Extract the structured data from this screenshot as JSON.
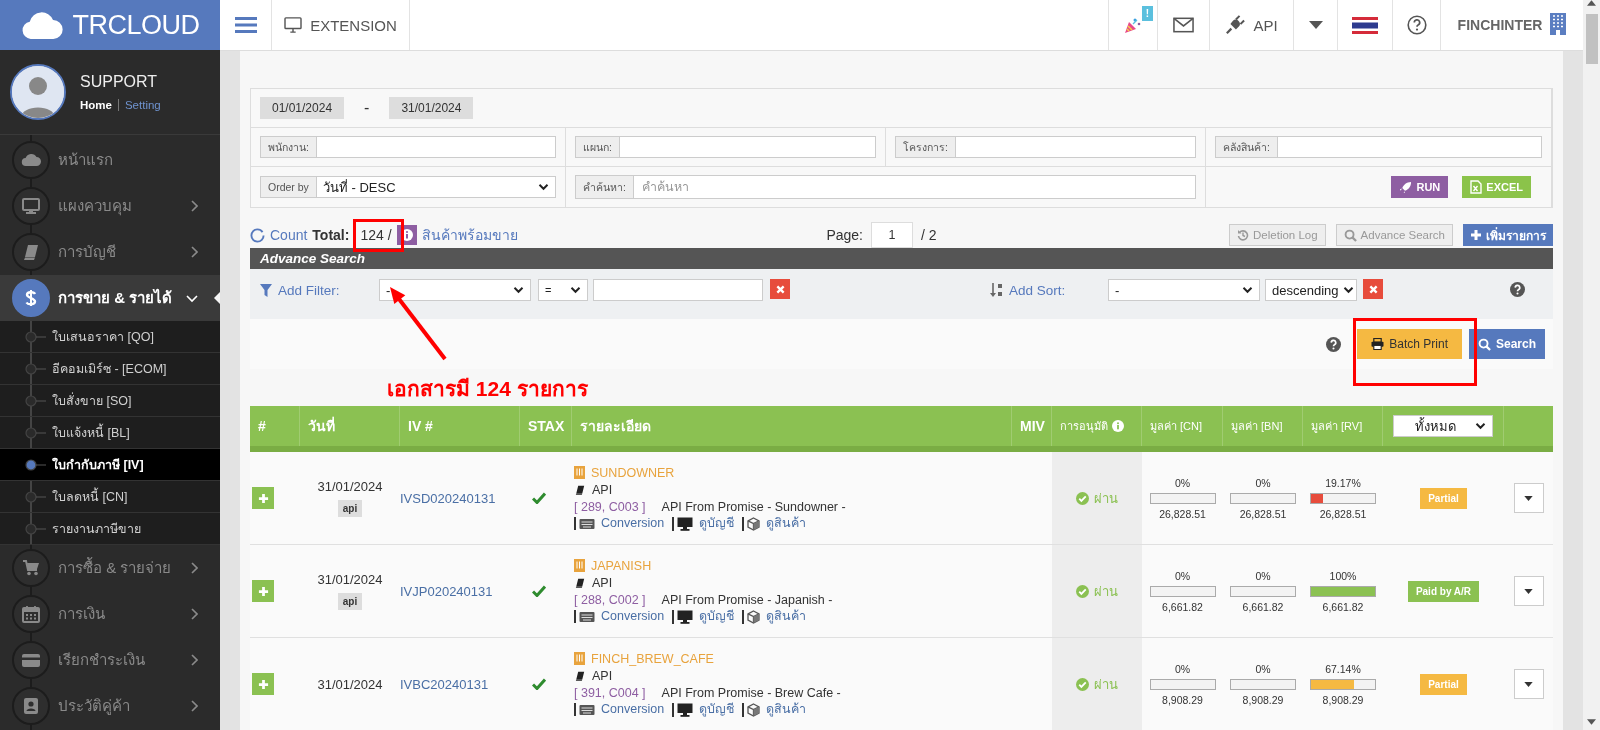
{
  "brand": {
    "logo": "**TR**CLOUD"
  },
  "profile": {
    "name": "SUPPORT",
    "home": "Home",
    "setting": "Setting"
  },
  "sidebar": {
    "items": [
      {
        "label": "หน้าแรก",
        "kind": "link",
        "expanded": false,
        "selected": false
      },
      {
        "label": "แผงควบคุม",
        "kind": "group",
        "expanded": false,
        "selected": false
      },
      {
        "label": "การบัญชี",
        "kind": "group",
        "expanded": false,
        "selected": false
      },
      {
        "label": "การขาย & รายได้",
        "kind": "group",
        "expanded": true,
        "selected": true,
        "children": [
          {
            "label": "ใบเสนอราคา [QO]",
            "selected": false
          },
          {
            "label": "อีคอมเมิร์ซ - [ECOM]",
            "selected": false
          },
          {
            "label": "ใบสั่งขาย [SO]",
            "selected": false
          },
          {
            "label": "ใบแจ้งหนี้ [BL]",
            "selected": false
          },
          {
            "label": "ใบกำกับภาษี [IV]",
            "selected": true
          },
          {
            "label": "ใบลดหนี้ [CN]",
            "selected": false
          },
          {
            "label": "รายงานภาษีขาย",
            "selected": false
          }
        ]
      },
      {
        "label": "การซื้อ & รายจ่าย",
        "kind": "group",
        "expanded": false,
        "selected": false
      },
      {
        "label": "การเงิน",
        "kind": "group",
        "expanded": false,
        "selected": false
      },
      {
        "label": "เรียกชำระเงิน",
        "kind": "group",
        "expanded": false,
        "selected": false
      },
      {
        "label": "ประวัติคู่ค้า",
        "kind": "group",
        "expanded": false,
        "selected": false
      }
    ]
  },
  "topbar": {
    "extension": "EXTENSION",
    "badge": "!",
    "api": "API",
    "company": "FINCHINTER"
  },
  "filters": {
    "date_from": "01/01/2024",
    "date_separator": "-",
    "date_to": "31/01/2024",
    "fields": [
      {
        "label": "พนักงาน:"
      },
      {
        "label": "แผนก:"
      },
      {
        "label": "โครงการ:"
      },
      {
        "label": "คลังสินค้า:"
      }
    ],
    "order_by": {
      "label": "Order by",
      "value": "วันที่ - DESC"
    },
    "search": {
      "label": "คำค้นหา:",
      "placeholder": "คำค้นหา"
    },
    "buttons": [
      {
        "label": "RUN",
        "kind": "run"
      },
      {
        "label": "EXCEL",
        "kind": "excel"
      }
    ]
  },
  "summary": {
    "count": "Count",
    "total_label": "Total:",
    "total": "124 /",
    "stock_link": "สินค้าพร้อมขาย",
    "page_label": "Page:",
    "page": "1",
    "page_total": "/ 2",
    "buttons": [
      {
        "label": "Deletion Log",
        "kind": "log"
      },
      {
        "label": "Advance Search",
        "kind": "search"
      },
      {
        "label": "เพิ่มรายการ",
        "kind": "add"
      }
    ]
  },
  "advance_search": {
    "title": "Advance Search",
    "filter_label": "Add Filter:",
    "filter_field": "-",
    "filter_operator": "=",
    "sort_label": "Add Sort:",
    "sort_field": "-",
    "sort_order": "descending",
    "batch_print": "Batch Print",
    "search": "Search"
  },
  "annotation": {
    "text": "เอกสารมี 124 รายการ"
  },
  "table": {
    "columns": [
      "#",
      "วันที่",
      "IV #",
      "STAX",
      "รายละเอียด",
      "MIV",
      "การอนุมัติ",
      "มูลค่า [CN]",
      "มูลค่า [BN]",
      "มูลค่า [RV]"
    ],
    "status_filter": "ทั้งหมด",
    "rows": [
      {
        "date": "31/01/2024",
        "tag": "api",
        "iv": "IVSD020240131",
        "stax": true,
        "company": "SUNDOWNER",
        "source": "API",
        "ref": "[ 289, C003 ]",
        "description": "API From Promise - Sundowner -",
        "links": [
          "Conversion",
          "ดูบัญชี",
          "ดูสินค้า"
        ],
        "approval": "ผ่าน",
        "values": [
          {
            "percent": "0%",
            "level": 0,
            "amount": "26,828.51"
          },
          {
            "percent": "0%",
            "level": 0,
            "amount": "26,828.51"
          },
          {
            "percent": "19.17%",
            "level": 0.1917,
            "amount": "26,828.51",
            "color": "#e74c3c"
          }
        ],
        "status": {
          "label": "Partial",
          "color": "#f5b942"
        }
      },
      {
        "date": "31/01/2024",
        "tag": "api",
        "iv": "IVJP020240131",
        "stax": true,
        "company": "JAPANISH",
        "source": "API",
        "ref": "[ 288, C002 ]",
        "description": "API From Promise - Japanish -",
        "links": [
          "Conversion",
          "ดูบัญชี",
          "ดูสินค้า"
        ],
        "approval": "ผ่าน",
        "values": [
          {
            "percent": "0%",
            "level": 0,
            "amount": "6,661.82"
          },
          {
            "percent": "0%",
            "level": 0,
            "amount": "6,661.82"
          },
          {
            "percent": "100%",
            "level": 1,
            "amount": "6,661.82",
            "color": "#8bc152"
          }
        ],
        "status": {
          "label": "Paid by A/R",
          "color": "#8bc152"
        }
      },
      {
        "date": "31/01/2024",
        "iv": "IVBC20240131",
        "stax": true,
        "company": "FINCH_BREW_CAFE",
        "source": "API",
        "ref": "[ 391, C004 ]",
        "description": "API From Promise - Brew Cafe -",
        "links": [
          "Conversion",
          "ดูบัญชี",
          "ดูสินค้า"
        ],
        "approval": "ผ่าน",
        "values": [
          {
            "percent": "0%",
            "level": 0,
            "amount": "8,908.29"
          },
          {
            "percent": "0%",
            "level": 0,
            "amount": "8,908.29"
          },
          {
            "percent": "67.14%",
            "level": 0.6714,
            "amount": "8,908.29",
            "color": "#f5b942"
          }
        ],
        "status": {
          "label": "Partial",
          "color": "#f5b942"
        }
      }
    ]
  }
}
